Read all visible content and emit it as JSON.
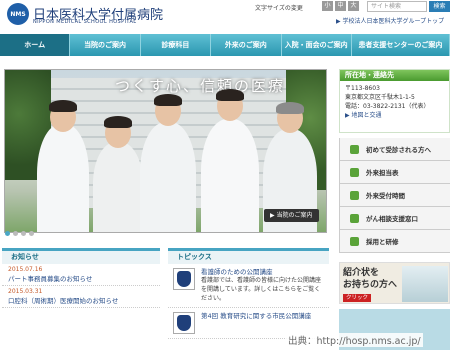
{
  "header": {
    "logo_mark": "NMS",
    "logo_ja": "日本医科大学付属病院",
    "logo_en": "NIPPON MEDICAL SCHOOL HOSPITAL",
    "font_size_label": "文字サイズの変更",
    "font_sizes": [
      "小",
      "中",
      "大"
    ],
    "search_placeholder": "サイト検索",
    "search_button": "検索",
    "group_link": "学校法人日本医科大学グループトップ"
  },
  "nav": {
    "items": [
      "ホーム",
      "当院のご案内",
      "診療科目",
      "外来のご案内",
      "入院・面会のご案内",
      "患者支援センターのご案内"
    ]
  },
  "hero": {
    "title": "つくす心、信頼の医療",
    "button": "当院のご案内",
    "slides": 4,
    "active_slide": 1
  },
  "access": {
    "heading": "所在地・連絡先",
    "postal": "〒113-8603",
    "address": "東京都文京区千駄木1-1-5",
    "phone": "電話：03-3822-2131（代表）",
    "link": "地図と交通"
  },
  "side_menu": [
    "初めて受診される方へ",
    "外来担当表",
    "外来受付時間",
    "がん相談支援窓口",
    "採用と研修"
  ],
  "banner": {
    "line1": "紹介状を",
    "line2": "お持ちの方へ",
    "click": "クリック"
  },
  "news": {
    "heading": "お知らせ",
    "items": [
      {
        "date": "2015.07.16",
        "text": "パート事務員募集のお知らせ"
      },
      {
        "date": "2015.03.31",
        "text": "口腔科（周術期）医療開始のお知らせ"
      }
    ]
  },
  "topics": {
    "heading": "トピックス",
    "items": [
      {
        "title": "看護師のための公開講座",
        "desc": "看護部では、看護師の皆様に向けた公開講座を開講しています。詳しくはこちらをご覧ください。"
      },
      {
        "title": "第4回 教育研究に関する市民公開講座",
        "desc": ""
      }
    ]
  },
  "credit": "出典：http://hosp.nms.ac.jp/"
}
